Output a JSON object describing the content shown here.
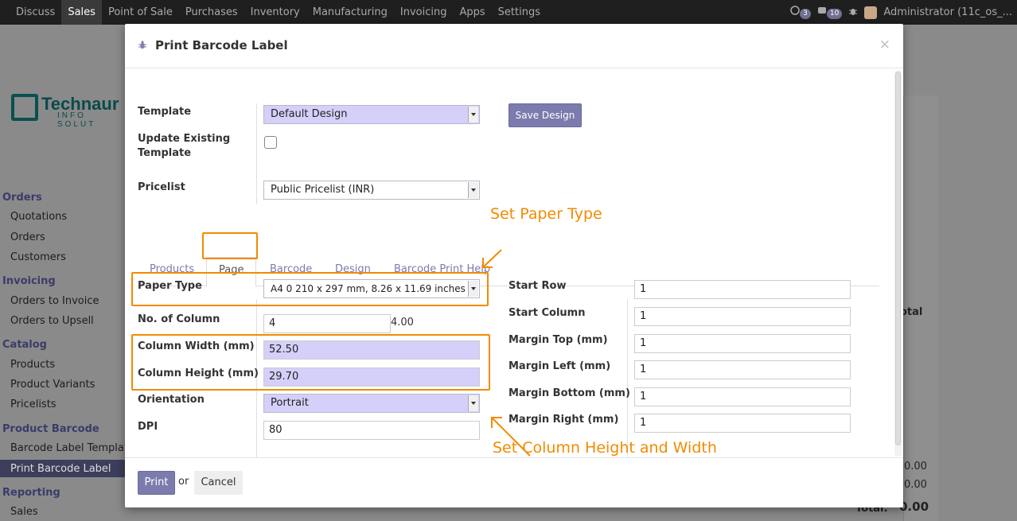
{
  "topbar": {
    "nav": [
      "Discuss",
      "Sales",
      "Point of Sale",
      "Purchases",
      "Inventory",
      "Manufacturing",
      "Invoicing",
      "Apps",
      "Settings"
    ],
    "active": "Sales",
    "chat_count": "3",
    "activity_count": "10",
    "user": "Administrator (11c_os_..."
  },
  "sidebar": {
    "logo_word": "Technaur",
    "logo_sub": "INFO SOLUT",
    "sections": [
      {
        "title": "Orders",
        "items": [
          "Quotations",
          "Orders",
          "Customers"
        ]
      },
      {
        "title": "Invoicing",
        "items": [
          "Orders to Invoice",
          "Orders to Upsell"
        ]
      },
      {
        "title": "Catalog",
        "items": [
          "Products",
          "Product Variants",
          "Pricelists"
        ]
      },
      {
        "title": "Product Barcode",
        "items": [
          "Barcode Label Template",
          "Print Barcode Label"
        ]
      },
      {
        "title": "Reporting",
        "items": [
          "Sales"
        ]
      }
    ]
  },
  "background": {
    "total_header": "otal",
    "amount1": "0.00",
    "amount2": "0.00",
    "total_label": "Total:",
    "total_value": "0.00"
  },
  "modal": {
    "title": "Print Barcode Label",
    "close": "×",
    "template_label": "Template",
    "template_value": "Default Design",
    "save_design": "Save Design",
    "update_label": "Update Existing Template",
    "pricelist_label": "Pricelist",
    "pricelist_value": "Public Pricelist (INR)",
    "tabs": [
      "Products",
      "Page",
      "Barcode",
      "Design",
      "Barcode Print Help"
    ],
    "active_tab": "Page",
    "left_fields": {
      "paper_type_label": "Paper Type",
      "paper_type_value": "A4 0 210 x 297 mm, 8.26 x 11.69 inches",
      "no_column_label": "No. of Column",
      "no_column_value": "4",
      "no_column_suffix": "4.00",
      "col_width_label": "Column Width (mm)",
      "col_width_value": "52.50",
      "col_height_label": "Column Height (mm)",
      "col_height_value": "29.70",
      "orientation_label": "Orientation",
      "orientation_value": "Portrait",
      "dpi_label": "DPI",
      "dpi_value": "80"
    },
    "right_fields": [
      {
        "label": "Start Row",
        "value": "1"
      },
      {
        "label": "Start Column",
        "value": "1"
      },
      {
        "label": "Margin Top (mm)",
        "value": "1"
      },
      {
        "label": "Margin Left (mm)",
        "value": "1"
      },
      {
        "label": "Margin Bottom (mm)",
        "value": "1"
      },
      {
        "label": "Margin Right (mm)",
        "value": "1"
      }
    ],
    "footer": {
      "print": "Print",
      "or": "or",
      "cancel": "Cancel"
    }
  },
  "annotations": {
    "paper_type": "Set Paper Type",
    "column_size": "Set Column Height and Width"
  },
  "colors": {
    "accent": "#7c7bad",
    "annotation": "#f28b00",
    "required_field": "#d4d0fa"
  }
}
